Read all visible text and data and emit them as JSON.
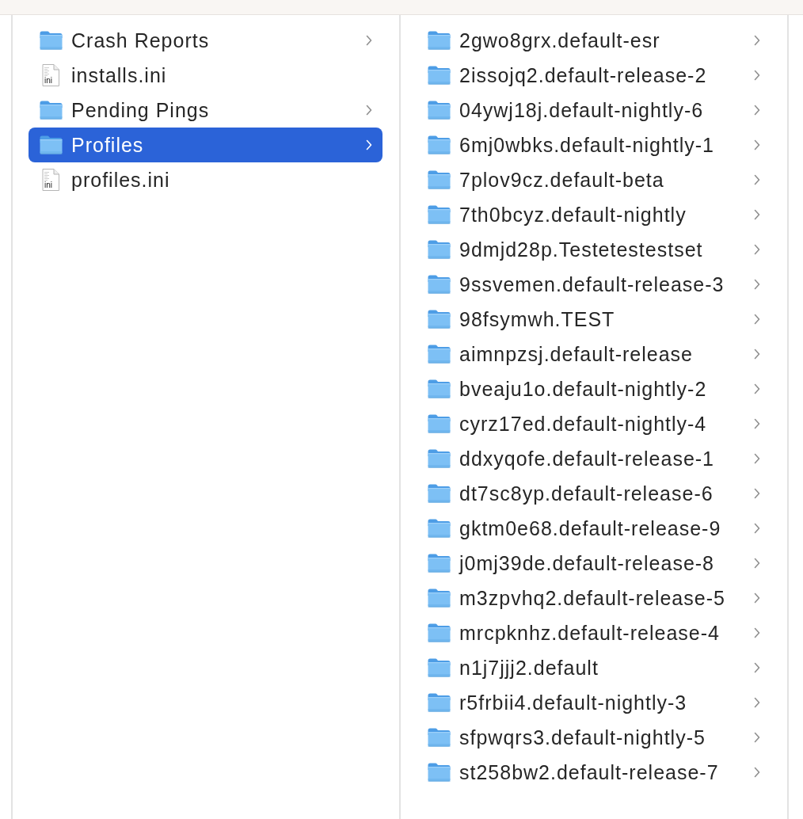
{
  "columns": [
    {
      "items": [
        {
          "name": "Crash Reports",
          "kind": "folder",
          "selected": false
        },
        {
          "name": "installs.ini",
          "kind": "file",
          "icon_label": "ini",
          "selected": false
        },
        {
          "name": "Pending Pings",
          "kind": "folder",
          "selected": false
        },
        {
          "name": "Profiles",
          "kind": "folder",
          "selected": true
        },
        {
          "name": "profiles.ini",
          "kind": "file",
          "icon_label": "ini",
          "selected": false
        }
      ]
    },
    {
      "items": [
        {
          "name": "2gwo8grx.default-esr",
          "kind": "folder",
          "selected": false
        },
        {
          "name": "2issojq2.default-release-2",
          "kind": "folder",
          "selected": false
        },
        {
          "name": "04ywj18j.default-nightly-6",
          "kind": "folder",
          "selected": false
        },
        {
          "name": "6mj0wbks.default-nightly-1",
          "kind": "folder",
          "selected": false
        },
        {
          "name": "7plov9cz.default-beta",
          "kind": "folder",
          "selected": false
        },
        {
          "name": "7th0bcyz.default-nightly",
          "kind": "folder",
          "selected": false
        },
        {
          "name": "9dmjd28p.Testetestestset",
          "kind": "folder",
          "selected": false
        },
        {
          "name": "9ssvemen.default-release-3",
          "kind": "folder",
          "selected": false
        },
        {
          "name": "98fsymwh.TEST",
          "kind": "folder",
          "selected": false
        },
        {
          "name": "aimnpzsj.default-release",
          "kind": "folder",
          "selected": false
        },
        {
          "name": "bveaju1o.default-nightly-2",
          "kind": "folder",
          "selected": false
        },
        {
          "name": "cyrz17ed.default-nightly-4",
          "kind": "folder",
          "selected": false
        },
        {
          "name": "ddxyqofe.default-release-1",
          "kind": "folder",
          "selected": false
        },
        {
          "name": "dt7sc8yp.default-release-6",
          "kind": "folder",
          "selected": false
        },
        {
          "name": "gktm0e68.default-release-9",
          "kind": "folder",
          "selected": false
        },
        {
          "name": "j0mj39de.default-release-8",
          "kind": "folder",
          "selected": false
        },
        {
          "name": "m3zpvhq2.default-release-5",
          "kind": "folder",
          "selected": false
        },
        {
          "name": "mrcpknhz.default-release-4",
          "kind": "folder",
          "selected": false
        },
        {
          "name": "n1j7jjj2.default",
          "kind": "folder",
          "selected": false
        },
        {
          "name": "r5frbii4.default-nightly-3",
          "kind": "folder",
          "selected": false
        },
        {
          "name": "sfpwqrs3.default-nightly-5",
          "kind": "folder",
          "selected": false
        },
        {
          "name": "st258bw2.default-release-7",
          "kind": "folder",
          "selected": false
        }
      ]
    }
  ]
}
